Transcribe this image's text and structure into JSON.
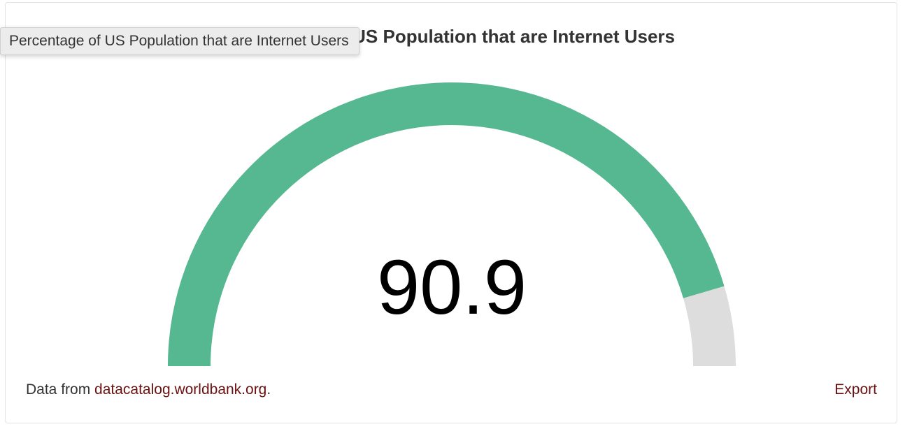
{
  "chart": {
    "title": "Percentage of US Population that are Internet Users",
    "value_label": "90.9"
  },
  "chart_data": {
    "type": "gauge",
    "value": 90.9,
    "min": 0,
    "max": 100,
    "colors": {
      "filled": "#55b891",
      "track": "#dddddd"
    }
  },
  "footer": {
    "source_prefix": "Data from ",
    "source_link": "datacatalog.worldbank.org",
    "source_suffix": ".",
    "export_label": "Export"
  },
  "tooltip": {
    "text": "Percentage of US Population that are Internet Users"
  }
}
